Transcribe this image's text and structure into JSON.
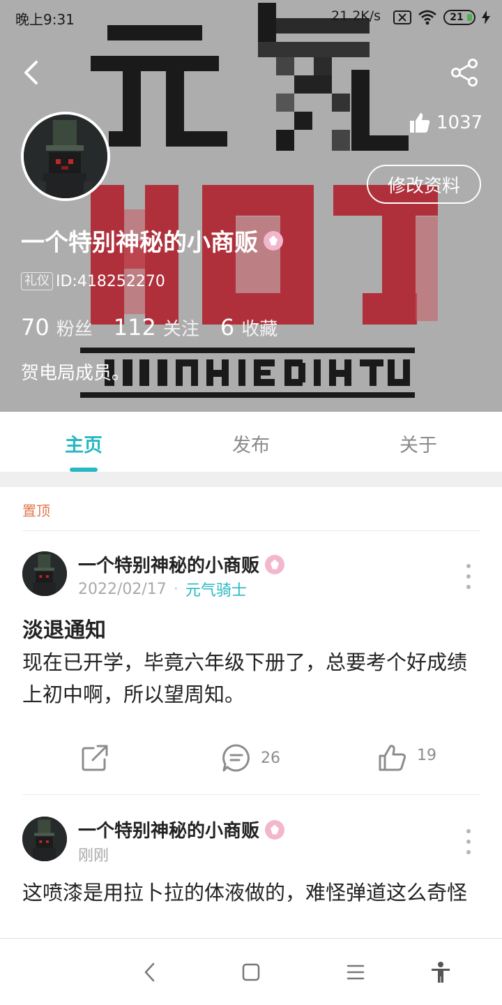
{
  "status_bar": {
    "time": "晚上9:31",
    "net_speed": "21.2K/s",
    "battery": "21"
  },
  "profile": {
    "likes": "1037",
    "edit_label": "修改资料",
    "name": "一个特别神秘的小商贩",
    "tag": "礼仪",
    "id": "ID:418252270",
    "stats": [
      {
        "value": "70",
        "label": "粉丝"
      },
      {
        "value": "112",
        "label": "关注"
      },
      {
        "value": "6",
        "label": "收藏"
      }
    ],
    "bio": "贺电局成员。"
  },
  "tabs": [
    {
      "label": "主页",
      "active": true
    },
    {
      "label": "发布",
      "active": false
    },
    {
      "label": "关于",
      "active": false
    }
  ],
  "feed": {
    "pinned_label": "置顶",
    "posts": [
      {
        "author": "一个特别神秘的小商贩",
        "date": "2022/02/17",
        "channel": "元气骑士",
        "title": "淡退通知",
        "body": "现在已开学，毕竟六年级下册了，总要考个好成绩上初中啊，所以望周知。",
        "comments": "26",
        "likes": "19"
      },
      {
        "author": "一个特别神秘的小商贩",
        "date": "刚刚",
        "body": "这喷漆是用拉卜拉的体液做的，难怪弹道这么奇怪"
      }
    ]
  },
  "colors": {
    "accent": "#27b8c2",
    "pinned": "#e0784c",
    "header_bg": "#adadad"
  },
  "icons": [
    "back-icon",
    "share-icon",
    "thumb-up-icon",
    "vip-badge-icon",
    "more-icon",
    "share-out-icon",
    "comment-icon",
    "like-icon",
    "nav-back-icon",
    "nav-home-icon",
    "nav-menu-icon",
    "accessibility-icon"
  ]
}
